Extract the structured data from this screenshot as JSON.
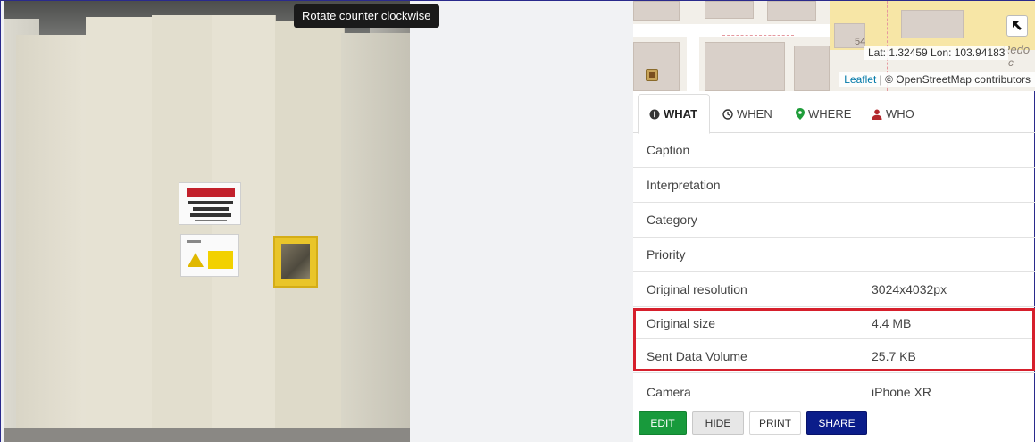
{
  "viewer": {
    "tooltip": "Rotate counter clockwise"
  },
  "map": {
    "label_54": "54",
    "label_redo": "Redo",
    "label_redo2": "c",
    "coords": "Lat: 1.32459 Lon: 103.94183",
    "attribution_leaflet": "Leaflet",
    "attribution_sep": " | ",
    "attribution_osm": "© OpenStreetMap contributors",
    "fullscreen_icon": "expand-arrow-icon"
  },
  "tabs": [
    {
      "label": "WHAT",
      "icon": "info-circle-icon",
      "active": true
    },
    {
      "label": "WHEN",
      "icon": "clock-icon",
      "active": false
    },
    {
      "label": "WHERE",
      "icon": "map-marker-icon",
      "active": false
    },
    {
      "label": "WHO",
      "icon": "user-icon",
      "active": false
    }
  ],
  "details": [
    {
      "label": "Caption",
      "value": ""
    },
    {
      "label": "Interpretation",
      "value": ""
    },
    {
      "label": "Category",
      "value": ""
    },
    {
      "label": "Priority",
      "value": ""
    },
    {
      "label": "Original resolution",
      "value": "3024x4032px"
    },
    {
      "label": "Original size",
      "value": "4.4 MB"
    },
    {
      "label": "Sent Data Volume",
      "value": "25.7 KB"
    },
    {
      "label": "Camera",
      "value": "iPhone XR"
    }
  ],
  "buttons": {
    "edit": "EDIT",
    "hide": "HIDE",
    "print": "PRINT",
    "share": "SHARE"
  },
  "colors": {
    "edit_green": "#189a3c",
    "share_navy": "#0b1d8a",
    "highlight_red": "#d61f2c",
    "where_green": "#1f9d3a",
    "who_red": "#b3282d"
  }
}
